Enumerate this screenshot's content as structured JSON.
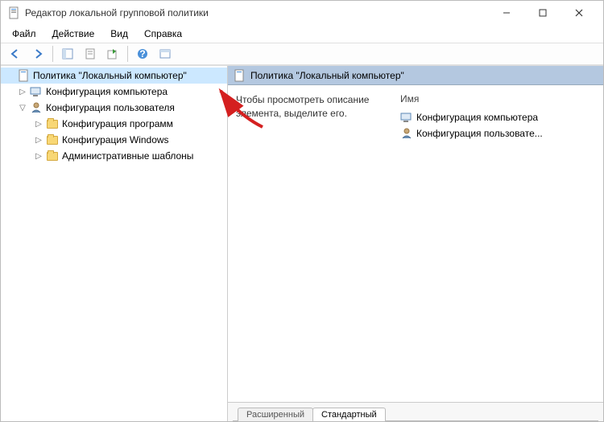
{
  "window": {
    "title": "Редактор локальной групповой политики"
  },
  "menu": {
    "file": "Файл",
    "action": "Действие",
    "view": "Вид",
    "help": "Справка"
  },
  "tree": {
    "root": "Политика \"Локальный компьютер\"",
    "computer_config": "Конфигурация компьютера",
    "user_config": "Конфигурация пользователя",
    "software_settings": "Конфигурация программ",
    "windows_settings": "Конфигурация Windows",
    "admin_templates": "Административные шаблоны"
  },
  "right_panel": {
    "header": "Политика \"Локальный компьютер\"",
    "description": "Чтобы просмотреть описание элемента, выделите его.",
    "column_name": "Имя",
    "items": {
      "computer": "Конфигурация компьютера",
      "user": "Конфигурация пользовате..."
    }
  },
  "tabs": {
    "extended": "Расширенный",
    "standard": "Стандартный"
  }
}
